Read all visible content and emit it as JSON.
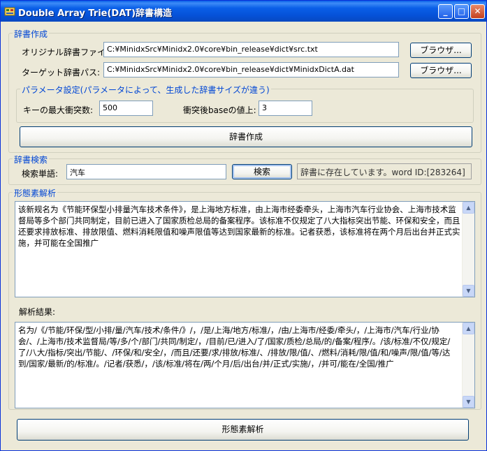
{
  "window": {
    "title": "Double Array Trie(DAT)辞書構造",
    "controls": {
      "minimize": "_",
      "maximize": "□",
      "close": "✕"
    }
  },
  "build": {
    "group_title": "辞書作成",
    "original_label": "オリジナル辞書ファイル",
    "original_value": "C:¥MinidxSrc¥Minidx2.0¥core¥bin_release¥dict¥src.txt",
    "target_label": "ターゲット辞書パス:",
    "target_value": "C:¥MinidxSrc¥Minidx2.0¥core¥bin_release¥dict¥MinidxDictA.dat",
    "browse_label": "ブラウザ...",
    "params": {
      "group_title": "パラメータ設定(パラメータによって、生成した辞書サイズが違う)",
      "max_conflict_label": "キーの最大衝突数:",
      "max_conflict_value": "500",
      "base_increment_label": "衝突後baseの値上:",
      "base_increment_value": "3"
    },
    "create_button": "辞書作成"
  },
  "search": {
    "group_title": "辞書検索",
    "word_label": "検索単語:",
    "word_value": "汽车",
    "search_button": "検索",
    "result": "辞書に存在しています。word ID:[283264]"
  },
  "morph": {
    "group_title": "形態素解析",
    "input_text": "该新规名为《节能环保型小排量汽车技术条件》，是上海地方标准，由上海市经委牵头，上海市汽车行业协会、上海市技术监督局等多个部门共同制定，目前已进入了国家质检总局的备案程序。该标准不仅规定了八大指标突出节能、环保和安全，而且还要求排放标准、排放限值、燃料消耗限值和噪声限值等达到国家最新的标准。记者获悉，该标准将在两个月后出台并正式实施，并可能在全国推广",
    "result_label": "解析結果:",
    "result_text": "名为/《/节能/环保/型/小排/量/汽车/技术/条件/》/，/是/上海/地方/标准/，/由/上海市/经委/牵头/，/上海市/汽车/行业/协会/、/上海市/技术监督局/等/多/个/部门/共同/制定/，/目前/已/进入/了/国家/质检/总局/的/备案/程序/。/该/标准/不仅/规定/了/八大/指标/突出/节能/、/环保/和/安全/，/而且/还要/求/排放/标准/、/排放/限/值/、/燃料/消耗/限/值/和/噪声/限/值/等/达到/国家/最新/的/标准/。/记者/获悉/，/该/标准/将在/两/个月/后/出台/并/正式/实施/，/并可/能在/全国/推广",
    "analyze_button": "形態素解析"
  },
  "icons": {
    "scroll_up": "up-arrow-icon",
    "scroll_down": "down-arrow-icon",
    "app": "app-icon"
  },
  "colors": {
    "title_bar": "#0a5fe8",
    "group_title": "#0046d5",
    "window_bg": "#ece9d8"
  }
}
